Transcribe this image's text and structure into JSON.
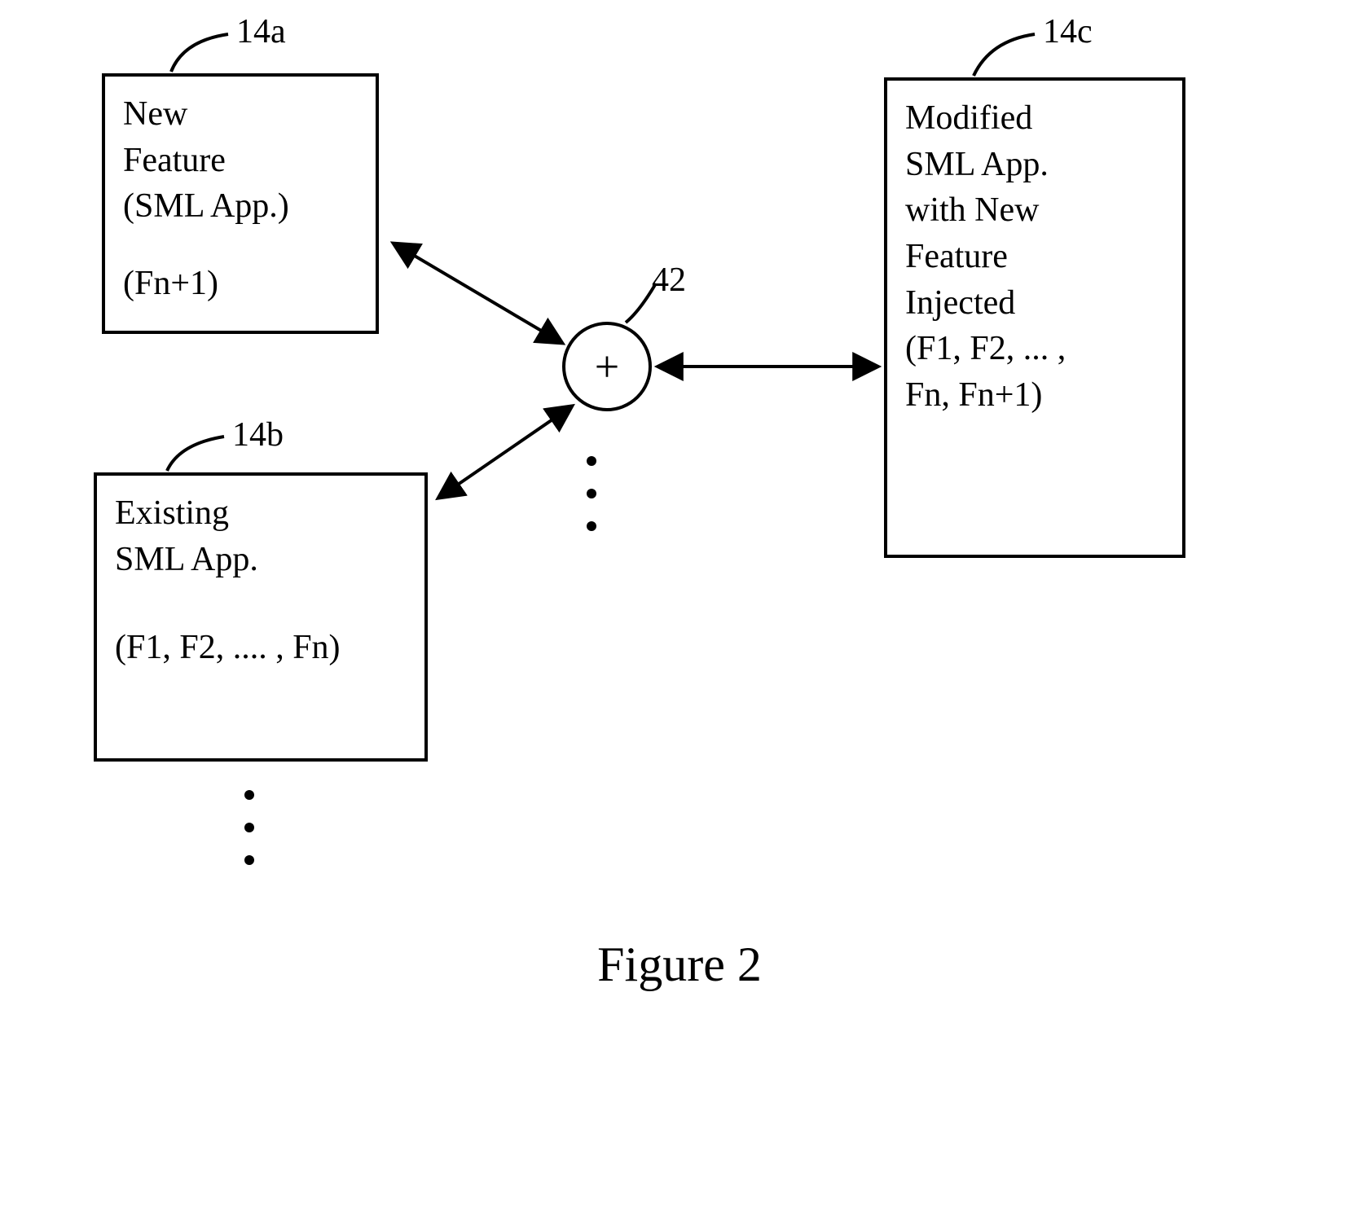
{
  "figure_label": "Figure 2",
  "boxes": {
    "a": {
      "ref": "14a",
      "line1": "New",
      "line2": "Feature",
      "line3": "(SML App.)",
      "line4": "(Fn+1)"
    },
    "b": {
      "ref": "14b",
      "line1": "Existing",
      "line2": "SML App.",
      "line3": "(F1, F2, .... , Fn)"
    },
    "c": {
      "ref": "14c",
      "line1": "Modified",
      "line2": "SML App.",
      "line3": "with New",
      "line4": "Feature",
      "line5": "Injected",
      "line6": "(F1, F2, ... ,",
      "line7": "Fn, Fn+1)"
    }
  },
  "combiner": {
    "ref": "42",
    "symbol": "+"
  }
}
